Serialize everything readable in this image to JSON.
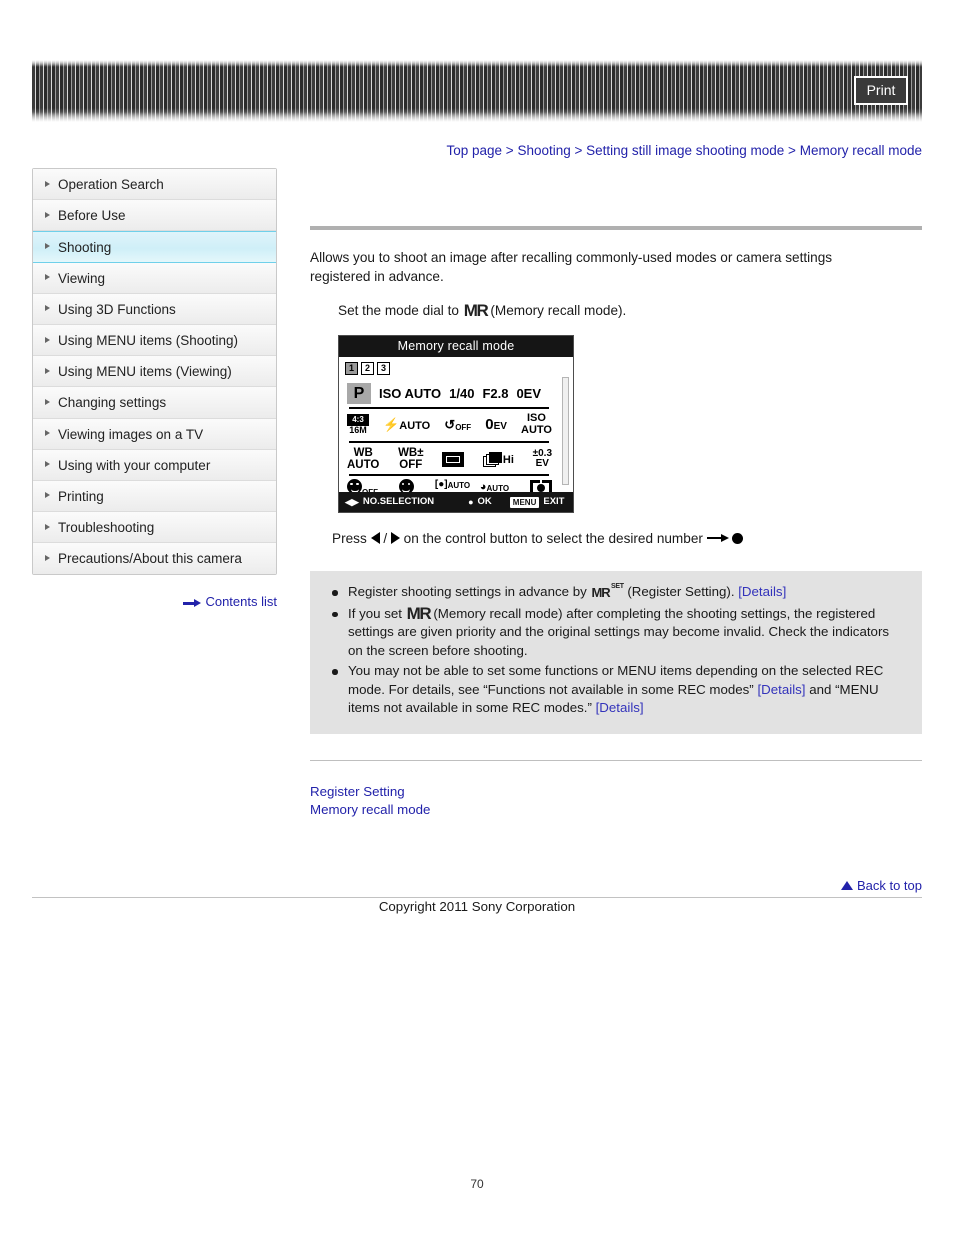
{
  "header": {
    "print_label": "Print"
  },
  "breadcrumb": {
    "separator": ">",
    "items": [
      {
        "label": "Top page"
      },
      {
        "label": "Shooting"
      },
      {
        "label": "Setting still image shooting mode"
      },
      {
        "label": "Memory recall mode"
      }
    ]
  },
  "sidebar": {
    "items": [
      {
        "label": "Operation Search",
        "active": false
      },
      {
        "label": "Before Use",
        "active": false
      },
      {
        "label": "Shooting",
        "active": true
      },
      {
        "label": "Viewing",
        "active": false
      },
      {
        "label": "Using 3D Functions",
        "active": false
      },
      {
        "label": "Using MENU items (Shooting)",
        "active": false
      },
      {
        "label": "Using MENU items (Viewing)",
        "active": false
      },
      {
        "label": "Changing settings",
        "active": false
      },
      {
        "label": "Viewing images on a TV",
        "active": false
      },
      {
        "label": "Using with your computer",
        "active": false
      },
      {
        "label": "Printing",
        "active": false
      },
      {
        "label": "Troubleshooting",
        "active": false
      },
      {
        "label": "Precautions/About this camera",
        "active": false
      }
    ],
    "contents_list_label": "Contents list"
  },
  "main": {
    "intro": "Allows you to shoot an image after recalling commonly-used modes or camera settings registered in advance.",
    "step_prefix": "Set the mode dial to",
    "step_mr": "MR",
    "step_suffix": "(Memory recall mode).",
    "press_prefix": "Press",
    "press_slash": "/",
    "press_middle": "on the control button to select the desired number"
  },
  "lcd": {
    "title": "Memory recall mode",
    "tabs": [
      "1",
      "2",
      "3"
    ],
    "selected_tab": "1",
    "row1": {
      "mode": "P",
      "iso": "ISO AUTO",
      "shutter": "1/40",
      "aperture": "F2.8",
      "ev": "0EV"
    },
    "row2": {
      "ratio": "4:3",
      "size": "16M",
      "flash": "AUTO",
      "timer": "OFF",
      "ev_value": "0",
      "ev_unit": "EV",
      "iso_label": "ISO",
      "iso_value": "AUTO"
    },
    "row3": {
      "wb_label": "WB",
      "wb_value": "AUTO",
      "wb_shift_label": "WB±",
      "wb_shift_value": "OFF",
      "burst_label": "Hi",
      "bracket_top": "±0.3",
      "bracket_bottom": "EV"
    },
    "row4": {
      "smile_detect": "OFF",
      "focus": "AUTO",
      "metering": "AUTO"
    },
    "footer": {
      "no_selection": "NO.SELECTION",
      "ok": "OK",
      "menu_key": "MENU",
      "exit": "EXIT"
    }
  },
  "notes": [
    {
      "prefix": "Register shooting settings in advance by",
      "icon": "MR",
      "icon_sup": "SET",
      "middle": "(Register Setting).",
      "link": "[Details]",
      "suffix": ""
    },
    {
      "prefix": "If you set",
      "icon": "MR",
      "middle": "(Memory recall mode) after completing the shooting settings, the registered settings are given priority and the original settings may become invalid. Check the indicators on the screen before shooting.",
      "link": "",
      "suffix": ""
    },
    {
      "prefix": "You may not be able to set some functions or MENU items depending on the selected REC mode. For details, see “Functions not available in some REC modes”",
      "icon": "",
      "middle": "",
      "link": "[Details]",
      "between": "and “MENU items not available in some REC modes.”",
      "link2": "[Details]",
      "suffix": ""
    }
  ],
  "related": {
    "links": [
      {
        "label": "Register Setting"
      },
      {
        "label": "Memory recall mode"
      }
    ]
  },
  "footer": {
    "back_to_top": "Back to top",
    "copyright": "Copyright 2011 Sony Corporation",
    "page_number": "70"
  }
}
